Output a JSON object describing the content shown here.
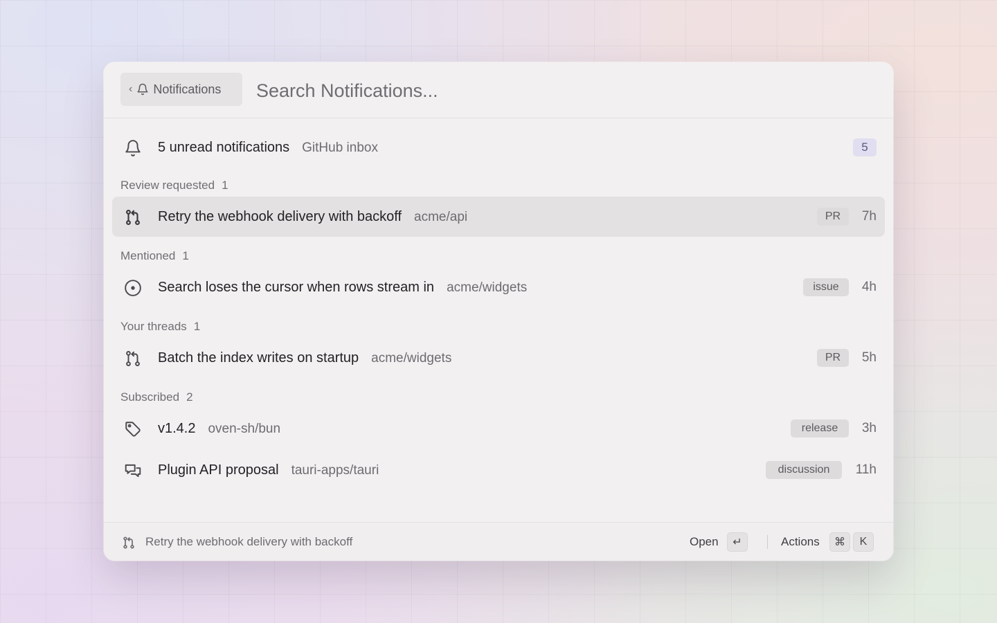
{
  "header": {
    "back_chip_label": "Notifications",
    "search_placeholder": "Search Notifications..."
  },
  "summary": {
    "title": "5 unread notifications",
    "subtitle": "GitHub inbox",
    "count": "5",
    "icon": "bell-icon"
  },
  "sections": [
    {
      "label": "Review requested",
      "count": "1",
      "items": [
        {
          "icon": "pull-request-icon",
          "title": "Retry the webhook delivery with backoff",
          "repo": "acme/api",
          "type": "PR",
          "age": "7h",
          "selected": true
        }
      ]
    },
    {
      "label": "Mentioned",
      "count": "1",
      "items": [
        {
          "icon": "issue-icon",
          "title": "Search loses the cursor when rows stream in",
          "repo": "acme/widgets",
          "type": "issue",
          "age": "4h"
        }
      ]
    },
    {
      "label": "Your threads",
      "count": "1",
      "items": [
        {
          "icon": "pull-request-icon",
          "title": "Batch the index writes on startup",
          "repo": "acme/widgets",
          "type": "PR",
          "age": "5h"
        }
      ]
    },
    {
      "label": "Subscribed",
      "count": "2",
      "items": [
        {
          "icon": "tag-icon",
          "title": "v1.4.2",
          "repo": "oven-sh/bun",
          "type": "release",
          "age": "3h"
        },
        {
          "icon": "discussion-icon",
          "title": "Plugin API proposal",
          "repo": "tauri-apps/tauri",
          "type": "discussion",
          "age": "11h"
        }
      ]
    }
  ],
  "footer": {
    "selected_title": "Retry the webhook delivery with backoff",
    "open_label": "Open",
    "enter_key": "↵",
    "actions_label": "Actions",
    "cmd_key": "⌘",
    "k_key": "K"
  }
}
